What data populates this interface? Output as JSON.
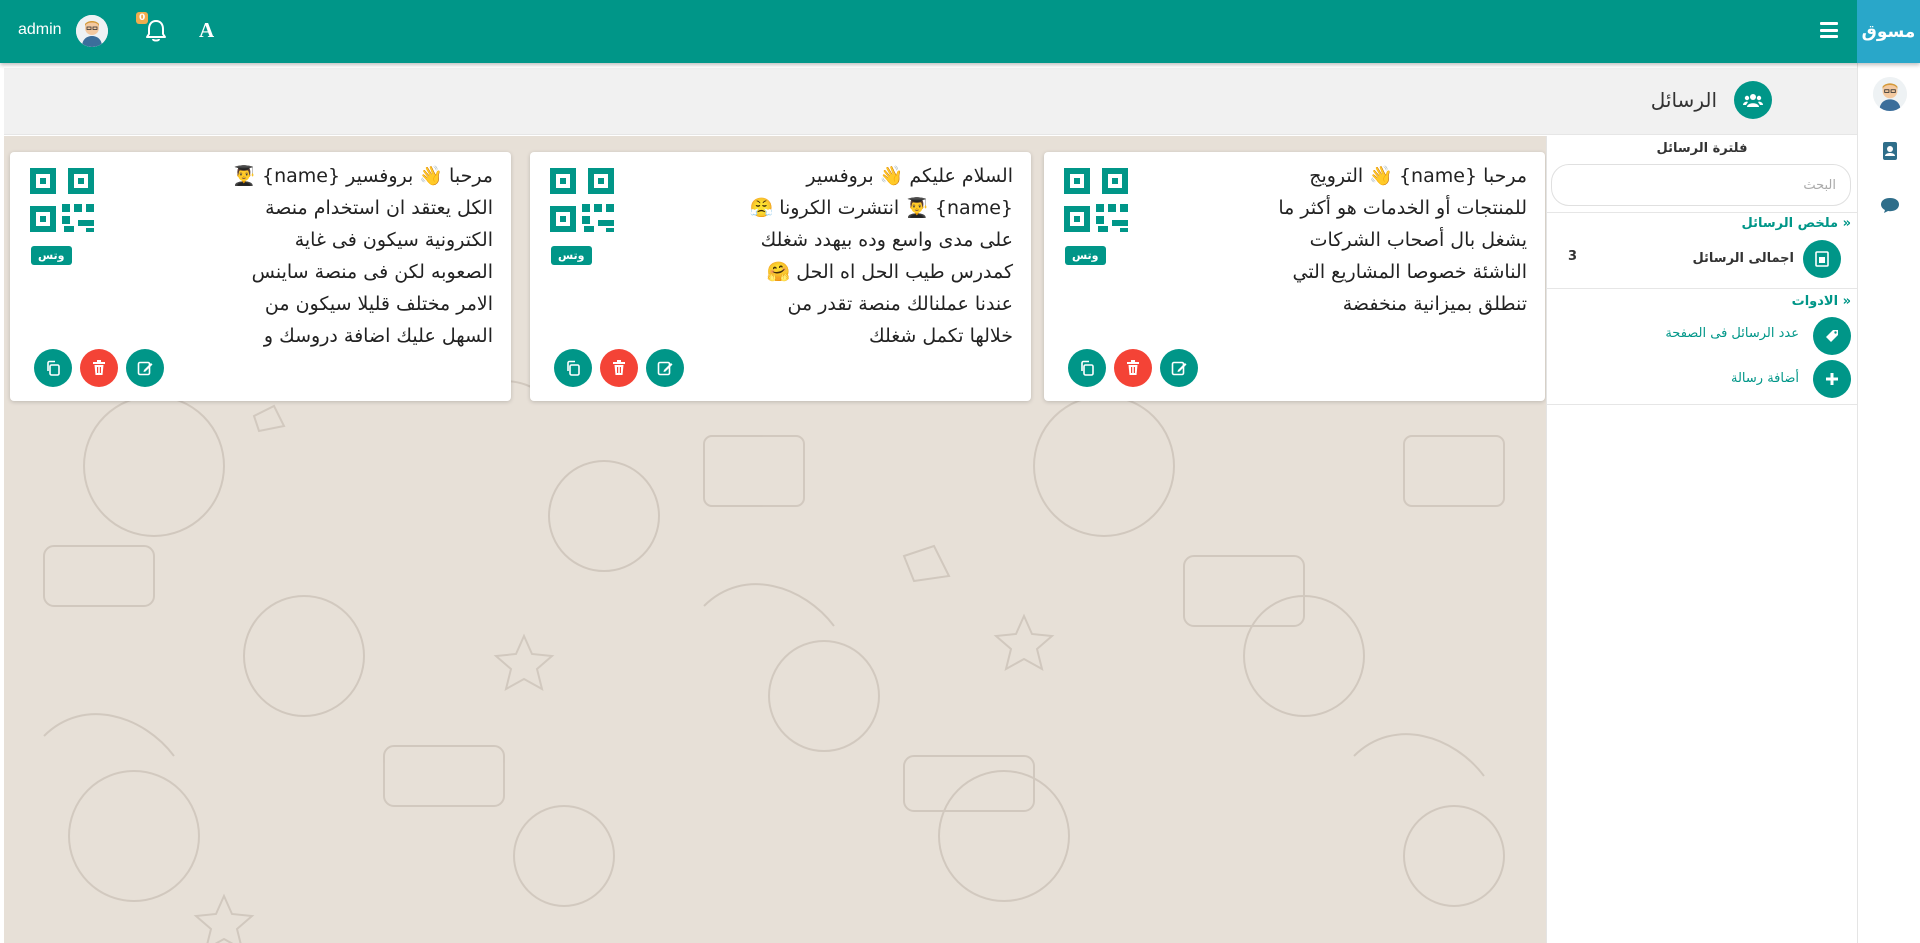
{
  "brand": "مسوق",
  "topbar": {
    "user": "admin",
    "notifications_count": "0",
    "font_button": "A"
  },
  "page": {
    "title": "الرسائل"
  },
  "filter": {
    "title": "فلترة الرسائل",
    "search_placeholder": "البحث",
    "summary_head": "« ملخص الرسائل",
    "total_label": "اجمالى الرسائل",
    "total_value": "3",
    "tools_head": "« الادوات",
    "per_page_label": "عدد الرسائل فى الصفحة",
    "add_label": "أضافة رسالة"
  },
  "cards": [
    {
      "text": "مرحبا {name} 👋 الترويج للمنتجات أو الخدمات هو أكثر ما يشغل بال أصحاب الشركات الناشئة خصوصا المشاريع التي تنطلق بميزانية منخفضة",
      "badge": "وتس"
    },
    {
      "text": "السلام عليكم 👋 بروفسير {name} 👨‍🎓 انتشرت الكرونا 😤 على مدى واسع وده بيهدد شغلك كمدرس طيب الحل اه الحل 🤗 عندنا عملنالك منصة تقدر من خلالها تكمل شغلك",
      "badge": "وتس"
    },
    {
      "text": "مرحبا 👋 بروفسير {name} 👨‍🎓 الكل يعتقد ان استخدام منصة الكترونية سيكون فى غاية الصعوبه لكن فى منصة ساينس الامر مختلف قليلا سيكون من السهل عليك اضافة دروسك و",
      "badge": "وتس"
    }
  ],
  "colors": {
    "primary": "#009688",
    "brand_bg": "#29a7c9",
    "danger": "#f44336",
    "wallpaper": "#e7e0d7"
  },
  "icons": [
    "hamburger-icon",
    "bell-icon",
    "users-icon",
    "contacts-icon",
    "comment-icon",
    "doc-icon",
    "tag-icon",
    "plus-icon",
    "edit-icon",
    "trash-icon",
    "copy-icon",
    "qr-icon"
  ]
}
